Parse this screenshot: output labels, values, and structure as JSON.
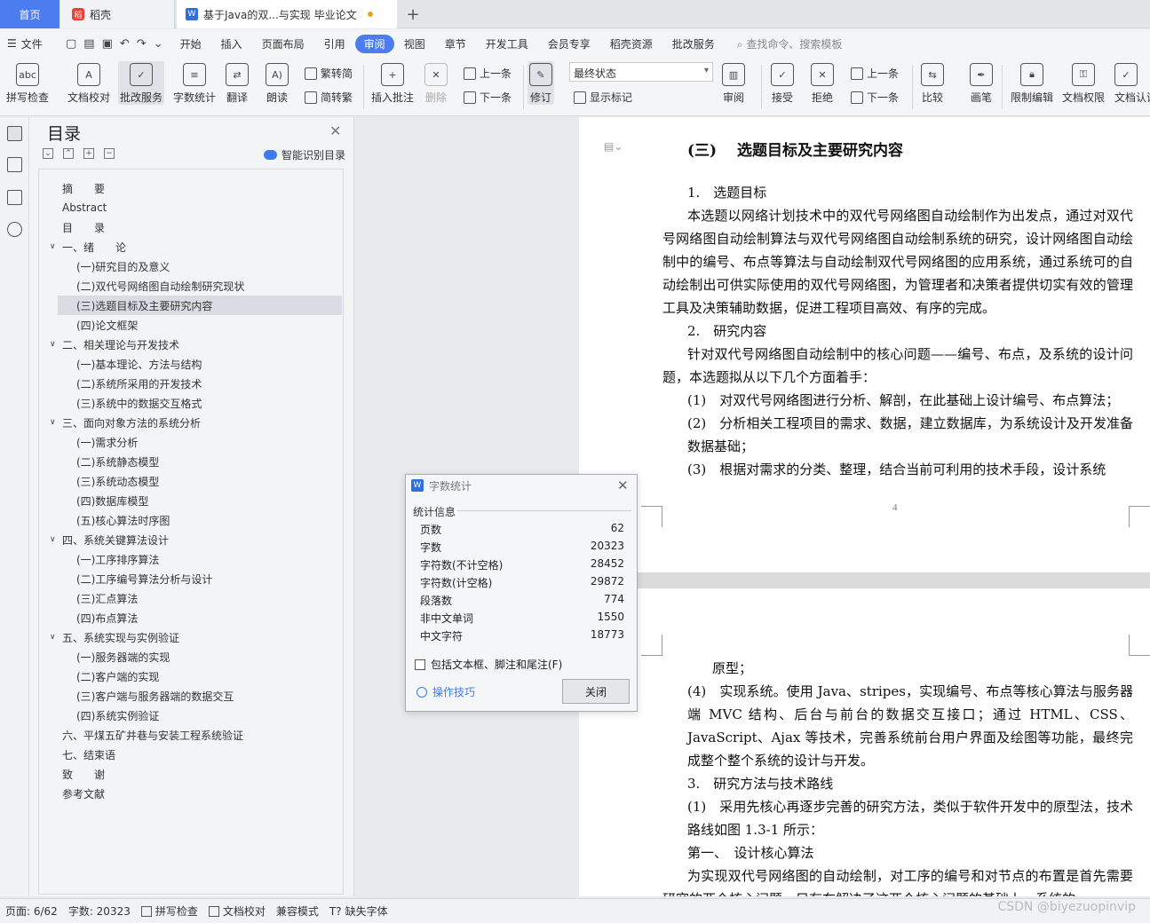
{
  "tabs": {
    "home": "首页",
    "daoke": "稻壳",
    "doc": "基于Java的双...与实现 毕业论文"
  },
  "menubar": {
    "file": "文件",
    "tabs": [
      "开始",
      "插入",
      "页面布局",
      "引用",
      "审阅",
      "视图",
      "章节",
      "开发工具",
      "会员专享",
      "稻壳资源",
      "批改服务"
    ],
    "active_tab": "审阅",
    "search": "查找命令、搜索模板"
  },
  "ribbon": {
    "spell": "拼写检查",
    "doc_check": "文档校对",
    "review_service": "批改服务",
    "word_count": "字数统计",
    "translate": "翻译",
    "read": "朗读",
    "trad": "繁转简",
    "simp": "简转繁",
    "insert_comment": "插入批注",
    "delete": "删除",
    "prev": "上一条",
    "next": "下一条",
    "track": "修订",
    "state": "最终状态",
    "show_marks": "显示标记",
    "review": "审阅",
    "accept": "接受",
    "reject": "拒绝",
    "prev2": "上一条",
    "next2": "下一条",
    "compare": "比较",
    "pen": "画笔",
    "restrict": "限制编辑",
    "perm": "文档权限",
    "cert": "文档认证"
  },
  "toc": {
    "title": "目录",
    "smart": "智能识别目录",
    "items": [
      "摘　　要",
      "Abstract",
      "目　　录",
      "一、绪　　论",
      "(一)研究目的及意义",
      "(二)双代号网络图自动绘制研究现状",
      "(三)选题目标及主要研究内容",
      "(四)论文框架",
      "二、相关理论与开发技术",
      "(一)基本理论、方法与结构",
      "(二)系统所采用的开发技术",
      "(三)系统中的数据交互格式",
      "三、面向对象方法的系统分析",
      "(一)需求分析",
      "(二)系统静态模型",
      "(三)系统动态模型",
      "(四)数据库模型",
      "(五)核心算法时序图",
      "四、系统关键算法设计",
      "(一)工序排序算法",
      "(二)工序编号算法分析与设计",
      "(三)汇点算法",
      "(四)布点算法",
      "五、系统实现与实例验证",
      "(一)服务器端的实现",
      "(二)客户端的实现",
      "(三)客户端与服务器端的数据交互",
      "(四)系统实例验证",
      "六、平煤五矿井巷与安装工程系统验证",
      "七、结束语",
      "致　　谢",
      "参考文献"
    ]
  },
  "doc": {
    "heading": "(三)　 选题目标及主要研究内容",
    "p1_title": "1.　选题目标",
    "p1": "本选题以网络计划技术中的双代号网络图自动绘制作为出发点，通过对双代号网络图自动绘制算法与双代号网络图自动绘制系统的研究，设计网络图自动绘制中的编号、布点等算法与自动绘制双代号网络图的应用系统，通过系统可的自动绘制出可供实际使用的双代号网络图，为管理者和决策者提供切实有效的管理工具及决策辅助数据，促进工程项目高效、有序的完成。",
    "p2_title": "2.　研究内容",
    "p2": "针对双代号网络图自动绘制中的核心问题——编号、布点，及系统的设计问题，本选题拟从以下几个方面着手：",
    "l1": "(1)　对双代号网络图进行分析、解剖，在此基础上设计编号、布点算法；",
    "l2": "(2)　分析相关工程项目的需求、数据，建立数据库，为系统设计及开发准备数据基础；",
    "l3": "(3)　根据对需求的分类、整理，结合当前可利用的技术手段，设计系统",
    "page_no": "4",
    "l3b": "原型；",
    "l4": "(4)　实现系统。使用 Java、stripes，实现编号、布点等核心算法与服务器端 MVC 结构、后台与前台的数据交互接口；通过 HTML、CSS、JavaScript、Ajax 等技术，完善系统前台用户界面及绘图等功能，最终完成整个整个系统的设计与开发。",
    "p3_title": "3.　研究方法与技术路线",
    "l5": "(1)　采用先核心再逐步完善的研究方法，类似于软件开发中的原型法，技术路线如图 1.3-1 所示：",
    "step1": "第一、　设计核心算法",
    "p4": "为实现双代号网络图的自动绘制，对工序的编号和对节点的布置是首先需要研究的两个核心问题，只有在解决了这两个核心问题的基础上，系统的"
  },
  "dialog": {
    "title": "字数统计",
    "section": "统计信息",
    "rows": [
      {
        "k": "页数",
        "v": "62"
      },
      {
        "k": "字数",
        "v": "20323"
      },
      {
        "k": "字符数(不计空格)",
        "v": "28452"
      },
      {
        "k": "字符数(计空格)",
        "v": "29872"
      },
      {
        "k": "段落数",
        "v": "774"
      },
      {
        "k": "非中文单词",
        "v": "1550"
      },
      {
        "k": "中文字符",
        "v": "18773"
      }
    ],
    "checkbox": "包括文本框、脚注和尾注(F)",
    "tips": "操作技巧",
    "close": "关闭"
  },
  "status": {
    "page": "页面: 6/62",
    "words": "字数: 20323",
    "spell": "拼写检查",
    "check": "文档校对",
    "compat": "兼容模式",
    "font": "缺失字体"
  },
  "watermark": "CSDN @biyezuopinvip"
}
